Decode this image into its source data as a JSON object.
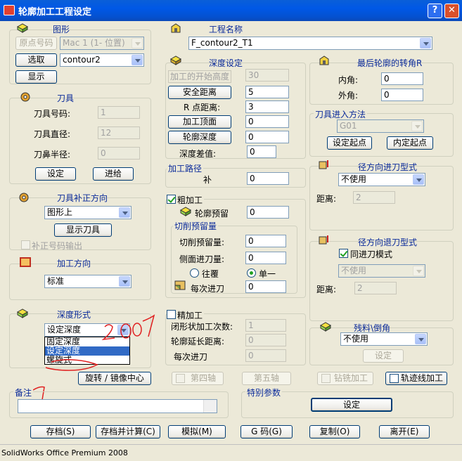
{
  "window": {
    "title": "轮廓加工工程设定",
    "help": "?",
    "close": "✕"
  },
  "shape": {
    "title": "图形",
    "origin_no": "原点号码",
    "origin_value": "Mac 1 (1- 位置)",
    "select_btn": "选取",
    "contour_value": "contour2",
    "show_btn": "显示"
  },
  "tool": {
    "title": "刀具",
    "no_label": "刀具号码:",
    "no_value": "1",
    "dia_label": "刀具直径:",
    "dia_value": "12",
    "nose_label": "刀鼻半径:",
    "nose_value": "0",
    "set_btn": "设定",
    "feed_btn": "进给"
  },
  "comp_dir": {
    "title": "刀具补正方向",
    "value": "图形上",
    "show_tool_btn": "显示刀具",
    "comp_output": "补正号码输出"
  },
  "machining_dir": {
    "title": "加工方向",
    "value": "标准"
  },
  "depth_form": {
    "title": "深度形式",
    "value": "设定深度",
    "options": [
      "固定深度",
      "设定深度",
      "螺旋式"
    ]
  },
  "project": {
    "title": "工程名称",
    "value": "F_contour2_T1"
  },
  "depth": {
    "title": "深度设定",
    "start_label": "加工的开始高度",
    "start_value": "30",
    "safe_btn": "安全距离",
    "safe_value": "5",
    "r_label": "R 点距离:",
    "r_value": "3",
    "top_btn": "加工顶面",
    "top_value": "0",
    "depth_btn": "轮廓深度",
    "depth_value": "0",
    "diff_label": "深度差值:",
    "diff_value": "0"
  },
  "path": {
    "title": "加工路径",
    "comp_label": "补",
    "comp_value": "0"
  },
  "rough": {
    "title": "粗加工",
    "allow_label": "轮廓预留",
    "allow_value": "0",
    "cut_title": "切削预留量",
    "cut_allow_label": "切削预留量:",
    "cut_allow_value": "0",
    "side_label": "侧面进刀量:",
    "side_value": "0",
    "reciprocate": "往覆",
    "single": "单一",
    "step_label": "每次进刀",
    "step_value": "0"
  },
  "finish": {
    "title": "精加工",
    "closed_label": "闭形状加工次数:",
    "closed_value": "1",
    "ext_label": "轮廓延长距离:",
    "ext_value": "0",
    "step_label": "每次进刀",
    "step_value": "0"
  },
  "corner": {
    "title": "最后轮廓的转角R",
    "inner_label": "内角:",
    "inner_value": "0",
    "outer_label": "外角:",
    "outer_value": "0"
  },
  "entry": {
    "title": "刀具进入方法",
    "value": "G01",
    "set_start_btn": "设定起点",
    "inner_start_btn": "内定起点"
  },
  "radial_in": {
    "title": "径方向进刀型式",
    "value": "不使用",
    "dist_label": "距离:",
    "dist_value": "2"
  },
  "radial_out": {
    "title": "径方向退刀型式",
    "same_mode": "同进刀模式",
    "value": "不使用",
    "dist_label": "距离:",
    "dist_value": "2"
  },
  "chamfer": {
    "title": "残料\\倒角",
    "value": "不使用",
    "set_btn": "设定"
  },
  "axis": {
    "rotate_btn": "旋转 / 镜像中心",
    "fourth": "第四轴",
    "fifth": "第五轴",
    "drill": "钻铣加工",
    "trace": "轨迹线加工"
  },
  "note": {
    "title": "备注"
  },
  "special": {
    "title": "特别参数",
    "set_btn": "设定"
  },
  "bottom": {
    "save": "存档(S)",
    "save_calc": "存档并计算(C)",
    "simulate": "模拟(M)",
    "gcode": "G 码(G)",
    "copy": "复制(O)",
    "leave": "离开(E)"
  },
  "annotation": {
    "handwriting": "2007"
  },
  "status": {
    "text": "SolidWorks Office Premium 2008"
  }
}
